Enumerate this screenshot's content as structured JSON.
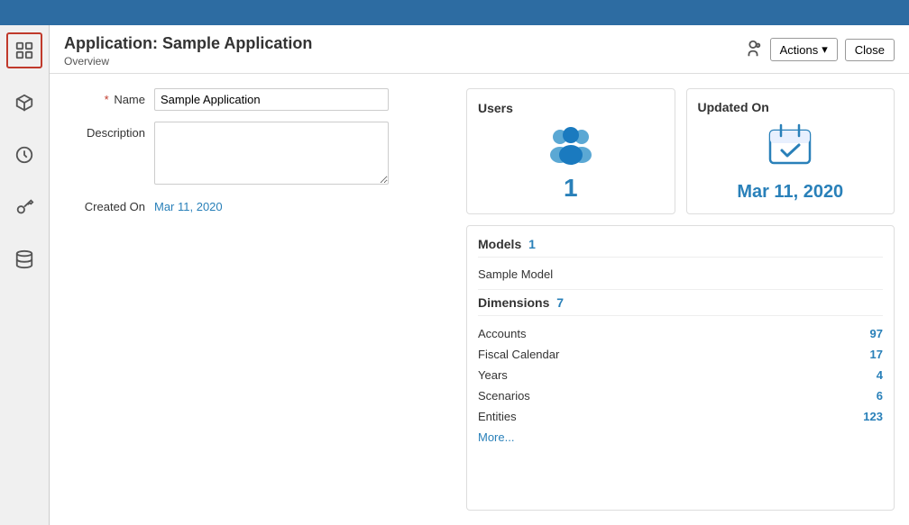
{
  "topbar": {
    "background": "#2d6ca2"
  },
  "header": {
    "title": "Application: Sample Application",
    "breadcrumb": "Overview",
    "actions_label": "Actions",
    "close_label": "Close"
  },
  "form": {
    "name_label": "Name",
    "name_required": "*",
    "name_value": "Sample Application",
    "description_label": "Description",
    "description_placeholder": "",
    "created_on_label": "Created On",
    "created_on_value": "Mar 11, 2020"
  },
  "users_card": {
    "title": "Users",
    "count": "1"
  },
  "updated_card": {
    "title": "Updated On",
    "date": "Mar 11, 2020"
  },
  "models_section": {
    "title": "Models",
    "count": "1",
    "items": [
      "Sample Model"
    ]
  },
  "dimensions_section": {
    "title": "Dimensions",
    "count": "7",
    "rows": [
      {
        "name": "Accounts",
        "count": "97"
      },
      {
        "name": "Fiscal Calendar",
        "count": "17"
      },
      {
        "name": "Years",
        "count": "4"
      },
      {
        "name": "Scenarios",
        "count": "6"
      },
      {
        "name": "Entities",
        "count": "123"
      }
    ],
    "more_label": "More..."
  },
  "sidebar": {
    "items": [
      {
        "icon": "grid-icon",
        "label": "Overview",
        "active": true
      },
      {
        "icon": "cube-icon",
        "label": "Models"
      },
      {
        "icon": "clock-icon",
        "label": "History"
      },
      {
        "icon": "key-icon",
        "label": "Access"
      },
      {
        "icon": "database-icon",
        "label": "Data"
      }
    ]
  }
}
